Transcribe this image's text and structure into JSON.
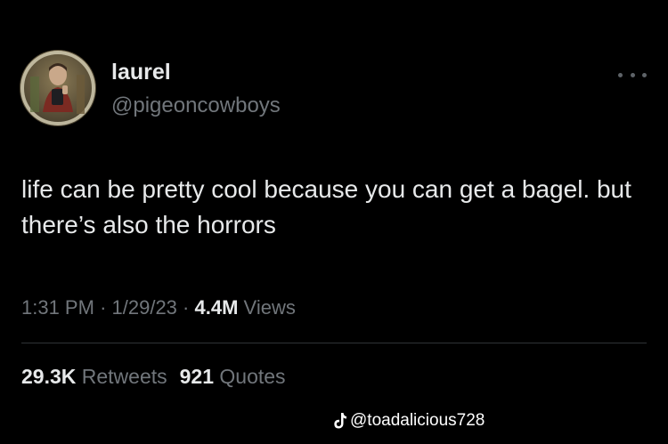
{
  "tweet": {
    "author": {
      "display_name": "laurel",
      "handle": "@pigeoncowboys",
      "avatar_icon": "profile-photo"
    },
    "more_icon": "more-horizontal-icon",
    "text": "life can be pretty cool because you can get a bagel. but there’s also the horrors",
    "meta": {
      "time": "1:31 PM",
      "separator": "·",
      "date": "1/29/23",
      "views_count": "4.4M",
      "views_label": "Views"
    },
    "stats": {
      "retweets_count": "29.3K",
      "retweets_label": "Retweets",
      "quotes_count": "921",
      "quotes_label": "Quotes"
    }
  },
  "watermark": {
    "icon": "tiktok-icon",
    "text": "@toadalicious728"
  },
  "colors": {
    "background": "#000000",
    "primary_text": "#e7e9ea",
    "secondary_text": "#71767b",
    "divider": "#2f3336"
  }
}
